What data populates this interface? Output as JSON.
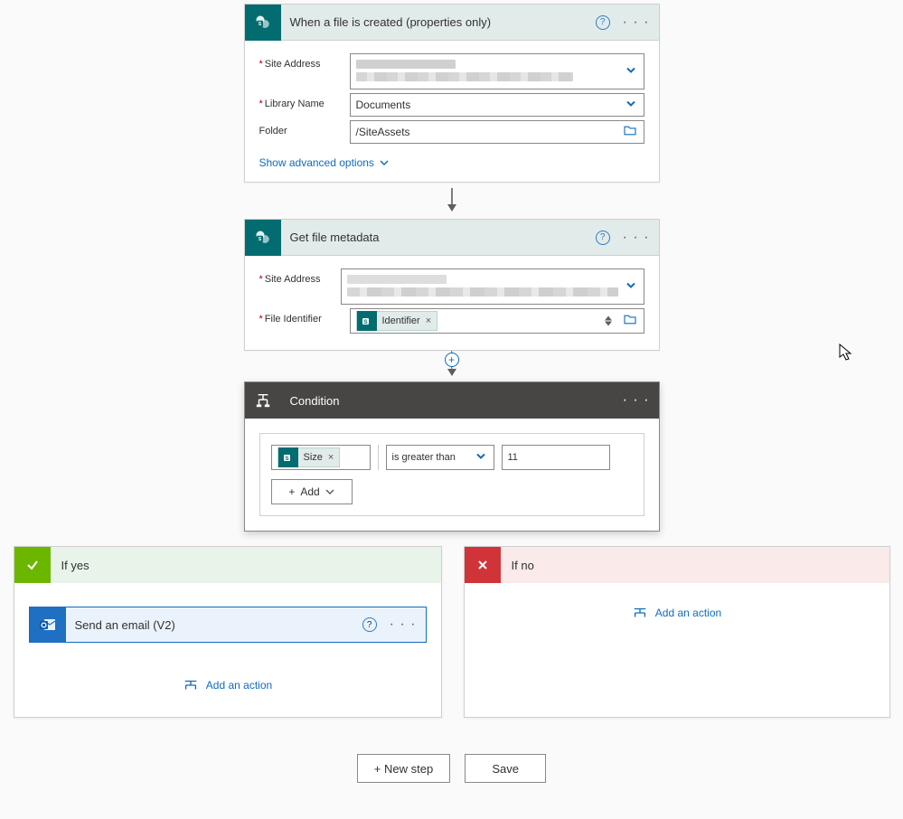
{
  "trigger": {
    "title": "When a file is created (properties only)",
    "fields": {
      "site_address_label": "Site Address",
      "library_name_label": "Library Name",
      "library_name_value": "Documents",
      "folder_label": "Folder",
      "folder_value": "/SiteAssets"
    },
    "advanced_link": "Show advanced options"
  },
  "get_metadata": {
    "title": "Get file metadata",
    "fields": {
      "site_address_label": "Site Address",
      "file_identifier_label": "File Identifier",
      "identifier_token": "Identifier"
    }
  },
  "condition": {
    "title": "Condition",
    "left_token": "Size",
    "operator": "is greater than",
    "value": "11",
    "add_label": "Add"
  },
  "branches": {
    "yes_label": "If yes",
    "no_label": "If no",
    "email_title": "Send an email (V2)",
    "add_action_label": "Add an action"
  },
  "footer": {
    "new_step": "+ New step",
    "save": "Save"
  }
}
